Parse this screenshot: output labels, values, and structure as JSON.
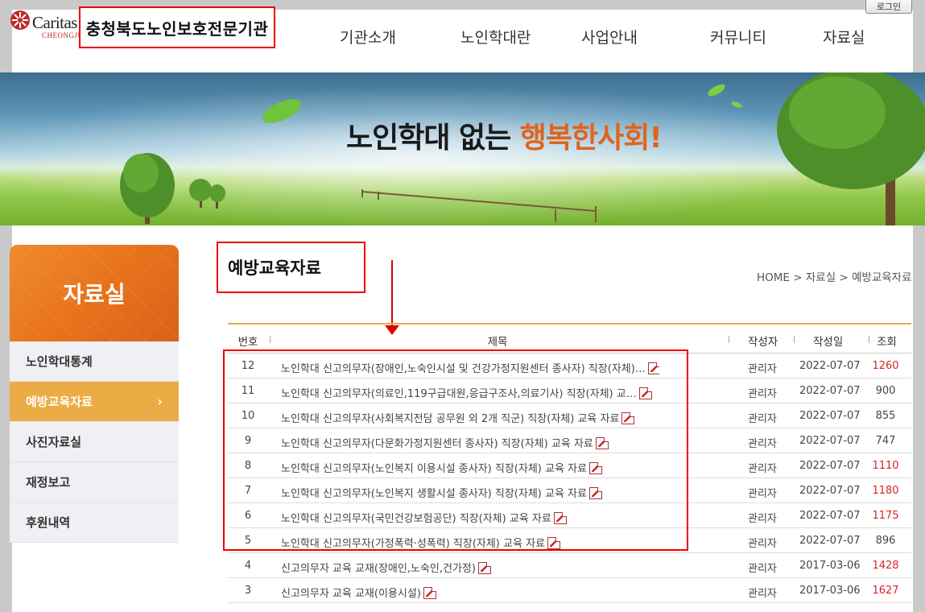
{
  "header": {
    "logo_text": "Caritas",
    "logo_sub": "CHEONGJU",
    "org_name": "충청북도노인보호전문기관",
    "login_label": "로그인",
    "nav": [
      "기관소개",
      "노인학대란",
      "사업안내",
      "커뮤니티",
      "자료실"
    ]
  },
  "banner": {
    "text_main": "노인학대 없는 ",
    "text_accent": "행복한사회!"
  },
  "sidebar": {
    "title": "자료실",
    "items": [
      {
        "label": "노인학대통계"
      },
      {
        "label": "예방교육자료",
        "chevron": "›"
      },
      {
        "label": "사진자료실"
      },
      {
        "label": "재정보고"
      },
      {
        "label": "후원내역"
      }
    ]
  },
  "content": {
    "title": "예방교육자료",
    "breadcrumb": "HOME > 자료실 > 예방교육자료"
  },
  "table": {
    "headers": {
      "no": "번호",
      "title": "제목",
      "author": "작성자",
      "date": "작성일",
      "views": "조회"
    },
    "rows": [
      {
        "no": "12",
        "title": "노인학대 신고의무자(장애인,노숙인시설 및 건강가정지원센터 종사자) 직장(자체)…",
        "author": "관리자",
        "date": "2022-07-07",
        "views": "1260"
      },
      {
        "no": "11",
        "title": "노인학대 신고의무자(의료인,119구급대원,응급구조사,의료기사) 직장(자체) 교…",
        "author": "관리자",
        "date": "2022-07-07",
        "views": "900"
      },
      {
        "no": "10",
        "title": "노인학대 신고의무자(사회복지전담 공무원 외 2개 직군) 직장(자체) 교육 자료",
        "author": "관리자",
        "date": "2022-07-07",
        "views": "855"
      },
      {
        "no": "9",
        "title": "노인학대 신고의무자(다문화가정지원센터 종사자) 직장(자체) 교육 자료",
        "author": "관리자",
        "date": "2022-07-07",
        "views": "747"
      },
      {
        "no": "8",
        "title": "노인학대 신고의무자(노인복지 이용시설 종사자) 직장(자체) 교육 자료",
        "author": "관리자",
        "date": "2022-07-07",
        "views": "1110"
      },
      {
        "no": "7",
        "title": "노인학대 신고의무자(노인복지 생활시설 종사자) 직장(자체) 교육 자료",
        "author": "관리자",
        "date": "2022-07-07",
        "views": "1180"
      },
      {
        "no": "6",
        "title": "노인학대 신고의무자(국민건강보험공단) 직장(자체) 교육 자료",
        "author": "관리자",
        "date": "2022-07-07",
        "views": "1175"
      },
      {
        "no": "5",
        "title": "노인학대 신고의무자(가정폭력·성폭력) 직장(자체) 교육 자료",
        "author": "관리자",
        "date": "2022-07-07",
        "views": "896"
      },
      {
        "no": "4",
        "title": "신고의무자 교육 교재(장애인,노숙인,건가정)",
        "author": "관리자",
        "date": "2017-03-06",
        "views": "1428"
      },
      {
        "no": "3",
        "title": "신고의무자 교육 교재(이용시설)",
        "author": "관리자",
        "date": "2017-03-06",
        "views": "1627"
      }
    ]
  },
  "colors": {
    "accent_orange": "#ecac45",
    "banner_accent": "#e0641e",
    "highlight_red": "#ee0000",
    "hot_views": "#dd2222"
  },
  "icons": [
    "caritas-logo-icon",
    "pdf-file-icon",
    "chevron-right-icon",
    "down-arrow-annotation"
  ]
}
